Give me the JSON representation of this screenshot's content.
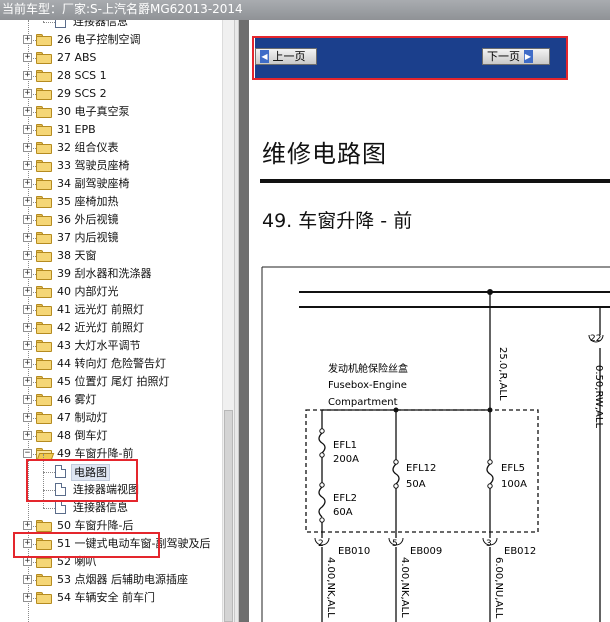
{
  "window": {
    "title": "当前车型：厂家:S-上汽名爵MG62013-2014"
  },
  "tree": {
    "items": [
      {
        "label": "连接器信息",
        "kind": "doc"
      },
      {
        "label": "26 电子控制空调",
        "kind": "folder"
      },
      {
        "label": "27 ABS",
        "kind": "folder"
      },
      {
        "label": "28 SCS 1",
        "kind": "folder"
      },
      {
        "label": "29 SCS 2",
        "kind": "folder"
      },
      {
        "label": "30 电子真空泵",
        "kind": "folder"
      },
      {
        "label": "31 EPB",
        "kind": "folder"
      },
      {
        "label": "32 组合仪表",
        "kind": "folder"
      },
      {
        "label": "33 驾驶员座椅",
        "kind": "folder"
      },
      {
        "label": "34 副驾驶座椅",
        "kind": "folder"
      },
      {
        "label": "35 座椅加热",
        "kind": "folder"
      },
      {
        "label": "36 外后视镜",
        "kind": "folder"
      },
      {
        "label": "37 内后视镜",
        "kind": "folder"
      },
      {
        "label": "38 天窗",
        "kind": "folder"
      },
      {
        "label": "39 刮水器和洗涤器",
        "kind": "folder"
      },
      {
        "label": "40 内部灯光",
        "kind": "folder"
      },
      {
        "label": "41 远光灯 前照灯",
        "kind": "folder"
      },
      {
        "label": "42 近光灯 前照灯",
        "kind": "folder"
      },
      {
        "label": "43 大灯水平调节",
        "kind": "folder"
      },
      {
        "label": "44 转向灯 危险警告灯",
        "kind": "folder"
      },
      {
        "label": "45 位置灯 尾灯 拍照灯",
        "kind": "folder"
      },
      {
        "label": "46 雾灯",
        "kind": "folder"
      },
      {
        "label": "47 制动灯",
        "kind": "folder"
      },
      {
        "label": "48 倒车灯",
        "kind": "folder"
      },
      {
        "label": "49 车窗升降-前",
        "kind": "folder-open"
      },
      {
        "label": "电路图",
        "kind": "doc-selected"
      },
      {
        "label": "连接器端视图",
        "kind": "doc"
      },
      {
        "label": "连接器信息",
        "kind": "doc"
      },
      {
        "label": "50 车窗升降-后",
        "kind": "folder"
      },
      {
        "label": "51 一键式电动车窗-副驾驶及后",
        "kind": "folder"
      },
      {
        "label": "52 喇叭",
        "kind": "folder"
      },
      {
        "label": "53 点烟器 后辅助电源插座",
        "kind": "folder"
      },
      {
        "label": "54 车辆安全 前车门",
        "kind": "folder"
      }
    ],
    "expander_collapsed": "+",
    "expander_expanded": "−"
  },
  "nav": {
    "prev_label": "上一页",
    "next_label": "下一页"
  },
  "document": {
    "heading": "维修电路图",
    "section_title": "49. 车窗升降 - 前",
    "diagram": {
      "fusebox_cn": "发动机舱保险丝盒",
      "fusebox_en_1": "Fusebox-Engine",
      "fusebox_en_2": "Compartment",
      "fuses": [
        {
          "name": "EFL1",
          "rating": "200A"
        },
        {
          "name": "EFL2",
          "rating": "60A"
        },
        {
          "name": "EFL12",
          "rating": "50A"
        },
        {
          "name": "EFL5",
          "rating": "100A"
        }
      ],
      "pins": [
        {
          "number": "2",
          "connector": "EB010",
          "wire": "4.00,NK,ALL"
        },
        {
          "number": "5",
          "connector": "EB009",
          "wire": "4.00,NK,ALL"
        },
        {
          "number": "3",
          "connector": "EB012",
          "wire": "6.00,NU,ALL"
        }
      ],
      "wire_top_center": "25.0,R,ALL",
      "wire_top_right": "0.50,RW,ALL",
      "pin_top_right": "22"
    }
  },
  "colors": {
    "titlebar": "#9b9ea2",
    "navbar": "#1b3f8c",
    "highlight_box": "#e4262d",
    "selection": "#dfe6f2"
  }
}
